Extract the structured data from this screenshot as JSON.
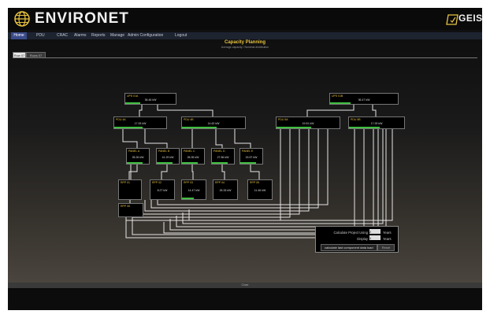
{
  "header": {
    "brand": "ENVIRONET",
    "vendor": "GEIST",
    "logo_icon": "globe-icon"
  },
  "nav": {
    "home": "Home",
    "items": [
      "PDU",
      "CRAC",
      "Alarms",
      "Reports",
      "Manage",
      "Admin Configuration",
      "Logout"
    ]
  },
  "page": {
    "title": "Capacity Planning",
    "subtitle": "Average capacity / Nominal distribution",
    "tabs": [
      "Row 07",
      "Rows 07"
    ],
    "footer": "Close"
  },
  "diagram": {
    "ups": [
      {
        "label": "UPS 01A",
        "value": "36.46 kW",
        "load": 0.3
      },
      {
        "label": "UPS 01B",
        "value": "36.47 kW",
        "load": 0.3
      }
    ],
    "pdus": [
      {
        "label": "PDU 4A",
        "value": "17.93 kW",
        "load": 0.55
      },
      {
        "label": "PDU 4B",
        "value": "14.62 kW",
        "load": 0.55
      },
      {
        "label": "PDU 5A",
        "value": "19.51 kW",
        "load": 0.55
      },
      {
        "label": "PDU 5B",
        "value": "17.93 kW",
        "load": 0.55
      }
    ],
    "panels": [
      {
        "label": "PANEL A",
        "value": "28.26 kW",
        "load": 0.7
      },
      {
        "label": "PANEL B",
        "value": "41.29 kW",
        "load": 0.7
      },
      {
        "label": "PANEL C",
        "value": "28.35 kW",
        "load": 0.7
      },
      {
        "label": "PANEL D",
        "value": "27.56 kW",
        "load": 0.7
      },
      {
        "label": "PANEL E",
        "value": "15.57 kW",
        "load": 0.7
      }
    ],
    "racks": [
      {
        "label": "RPP 01",
        "value": "",
        "load": 0
      },
      {
        "label": "RPP 02",
        "value": "8.27 kW",
        "load": 0
      },
      {
        "label": "RPP 03",
        "value": "14.47 kW",
        "load": 0.5
      },
      {
        "label": "RPP 04",
        "value": "26.33 kW",
        "load": 0
      },
      {
        "label": "RPP 05",
        "value": "11.46 kW",
        "load": 0
      },
      {
        "label": "RPP 06",
        "value": "",
        "load": 0
      }
    ]
  },
  "calculator": {
    "label1": "Calculate Project Using",
    "value1": "2",
    "unit1": "Years",
    "label2": "Display",
    "value2": "1",
    "unit2": "Years",
    "button": "calculate last component data load",
    "button2": "Reset"
  }
}
